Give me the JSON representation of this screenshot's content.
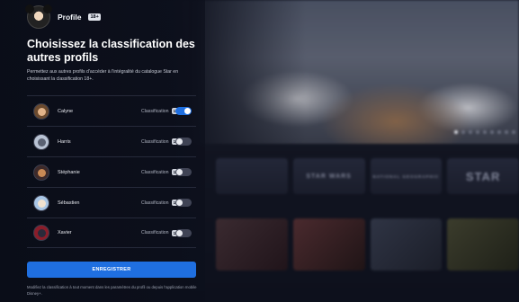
{
  "header": {
    "profile_name": "Profile",
    "profile_badge": "18+"
  },
  "title": "Choisissez la classification des autres profils",
  "description": "Permettez aux autres profils d'accéder à l'intégralité du catalogue Star en choisissant la classification 18+.",
  "profiles": [
    {
      "name": "Calyne",
      "classification_label": "Classification",
      "rating": "18+",
      "enabled": true
    },
    {
      "name": "Harris",
      "classification_label": "Classification",
      "rating": "18+",
      "enabled": false
    },
    {
      "name": "Stéphanie",
      "classification_label": "Classification",
      "rating": "18+",
      "enabled": false
    },
    {
      "name": "Sébastien",
      "classification_label": "Classification",
      "rating": "18+",
      "enabled": false
    },
    {
      "name": "Xavier",
      "classification_label": "Classification",
      "rating": "18+",
      "enabled": false
    }
  ],
  "save_button": "ENREGISTRER",
  "footnote": "Modifiez la classification à tout moment dans les paramètres du profil ou depuis l'application mobile Disney+.",
  "background": {
    "brand_tiles": [
      "",
      "STAR WARS",
      "NATIONAL GEOGRAPHIC",
      "STAR"
    ]
  },
  "colors": {
    "accent": "#1f6fe0",
    "panel_bg": "#0c0f1c",
    "toggle_off": "#3f4354"
  }
}
